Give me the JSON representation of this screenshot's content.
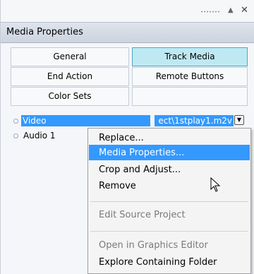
{
  "titlebar": {
    "pin_glyph": "▲",
    "close_glyph": "✕"
  },
  "header": {
    "title": "Media Properties"
  },
  "tabs": [
    {
      "label": "General",
      "active": false
    },
    {
      "label": "Track Media",
      "active": true
    },
    {
      "label": "End Action",
      "active": false
    },
    {
      "label": "Remote Buttons",
      "active": false
    },
    {
      "label": "Color Sets",
      "active": false
    },
    {
      "label": "",
      "active": false
    }
  ],
  "tree": {
    "video": {
      "label": "Video",
      "path": "ect\\1stplay1.m2v"
    },
    "audio": {
      "label": "Audio 1"
    }
  },
  "context_menu": {
    "items": [
      {
        "label": "Replace...",
        "enabled": true,
        "highlighted": false
      },
      {
        "label": "Media Properties...",
        "enabled": true,
        "highlighted": true
      },
      {
        "label": "Crop and Adjust...",
        "enabled": true,
        "highlighted": false
      },
      {
        "label": "Remove",
        "enabled": true,
        "highlighted": false
      },
      {
        "label": "Edit Source Project",
        "enabled": false,
        "highlighted": false
      },
      {
        "label": "Open in Graphics Editor",
        "enabled": false,
        "highlighted": false
      },
      {
        "label": "Explore Containing Folder",
        "enabled": true,
        "highlighted": false
      }
    ]
  },
  "colors": {
    "selection": "#3399ff",
    "active_tab": "#bfe9f2"
  }
}
